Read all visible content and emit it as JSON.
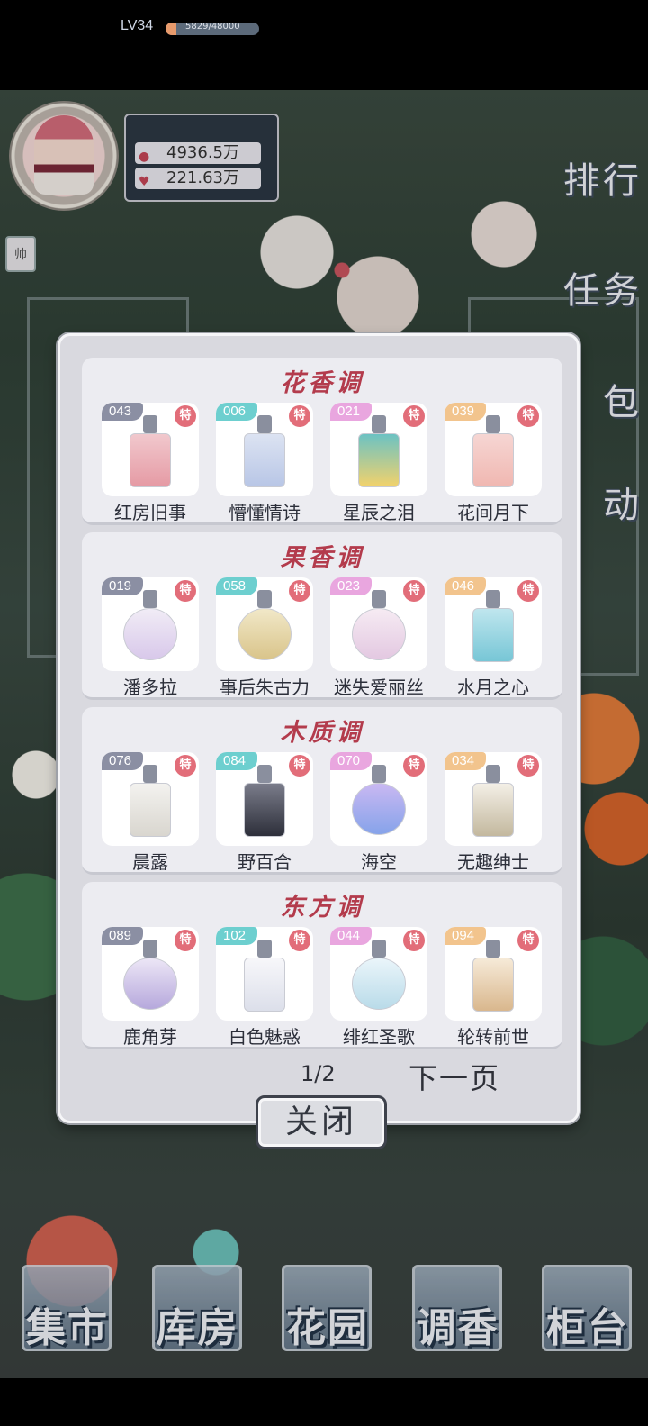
{
  "player": {
    "level": "LV34",
    "xp": "5829/48000",
    "xp_fraction": 0.12,
    "coins": "4936.5万",
    "hearts": "221.63万",
    "badge": "帅"
  },
  "side_menu": [
    "排行",
    "任务",
    "包",
    "动"
  ],
  "bottom_nav": [
    "集市",
    "库房",
    "花园",
    "调香",
    "柜台"
  ],
  "sections": [
    {
      "title": "花香调",
      "items": [
        {
          "id": "043",
          "name": "红房旧事",
          "tag_color": "#8b8fa3"
        },
        {
          "id": "006",
          "name": "懵懂情诗",
          "tag_color": "#6dcfcf"
        },
        {
          "id": "021",
          "name": "星辰之泪",
          "tag_color": "#e9a6df"
        },
        {
          "id": "039",
          "name": "花间月下",
          "tag_color": "#f2c48d"
        }
      ]
    },
    {
      "title": "果香调",
      "items": [
        {
          "id": "019",
          "name": "潘多拉",
          "tag_color": "#8b8fa3"
        },
        {
          "id": "058",
          "name": "事后朱古力",
          "tag_color": "#6dcfcf"
        },
        {
          "id": "023",
          "name": "迷失爱丽丝",
          "tag_color": "#e9a6df"
        },
        {
          "id": "046",
          "name": "水月之心",
          "tag_color": "#f2c48d"
        }
      ]
    },
    {
      "title": "木质调",
      "items": [
        {
          "id": "076",
          "name": "晨露",
          "tag_color": "#8b8fa3"
        },
        {
          "id": "084",
          "name": "野百合",
          "tag_color": "#6dcfcf"
        },
        {
          "id": "070",
          "name": "海空",
          "tag_color": "#e9a6df"
        },
        {
          "id": "034",
          "name": "无趣绅士",
          "tag_color": "#f2c48d"
        }
      ]
    },
    {
      "title": "东方调",
      "items": [
        {
          "id": "089",
          "name": "鹿角芽",
          "tag_color": "#8b8fa3"
        },
        {
          "id": "102",
          "name": "白色魅惑",
          "tag_color": "#6dcfcf"
        },
        {
          "id": "044",
          "name": "绯红圣歌",
          "tag_color": "#e9a6df"
        },
        {
          "id": "094",
          "name": "轮转前世",
          "tag_color": "#f2c48d"
        }
      ]
    }
  ],
  "special_label": "特",
  "pager": {
    "current": "1/2",
    "next_label": "下一页"
  },
  "close_label": "关闭"
}
